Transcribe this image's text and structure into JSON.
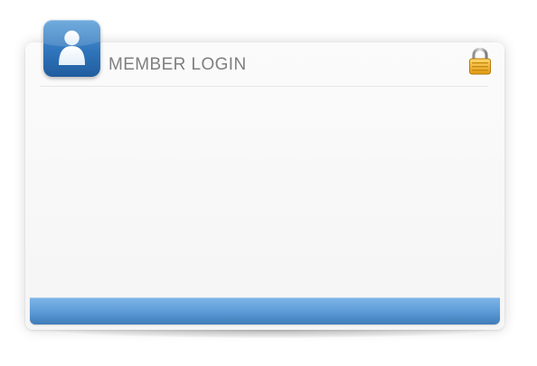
{
  "login_panel": {
    "title": "MEMBER LOGIN",
    "icons": {
      "avatar": "user-avatar-icon",
      "lock": "padlock-icon"
    },
    "colors": {
      "accent_blue": "#3f7fc1",
      "title_gray": "#7f7f7f",
      "lock_gold": "#f0b21b"
    }
  }
}
